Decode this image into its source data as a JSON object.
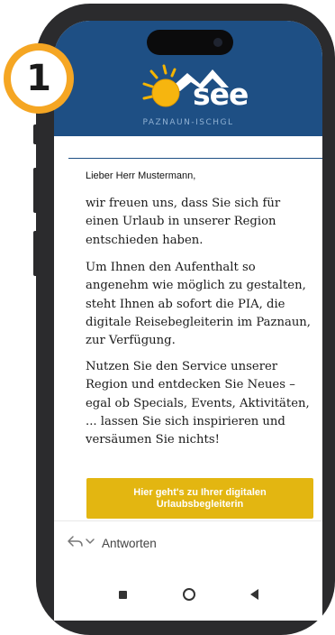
{
  "badge": {
    "number": "1"
  },
  "brand": {
    "logo_text": "see",
    "subtitle": "PAZNAUN-ISCHGL",
    "header_color": "#1e4f84",
    "accent_color": "#e3b611"
  },
  "email": {
    "greeting": "Lieber Herr Mustermann,",
    "paragraphs": [
      "wir freuen uns, dass Sie sich für einen Urlaub in unserer Region entschieden haben.",
      "Um Ihnen den Aufenthalt so angenehm wie möglich zu gestalten, steht Ihnen ab sofort die PIA, die digitale Reisebegleiterin im Paznaun, zur Verfügung.",
      "Nutzen Sie den Service unserer Region und entdecken Sie Neues – egal ob Specials, Events, Aktivitäten, ... lassen Sie sich inspirieren und versäumen Sie nichts!"
    ],
    "cta_label": "Hier geht's zu Ihrer digitalen Urlaubsbegleiterin"
  },
  "reply": {
    "label": "Antworten",
    "icon": "reply-icon",
    "chevron": "chevron-down-icon"
  },
  "navigation": {
    "recent": "recent-apps-icon",
    "home": "home-icon",
    "back": "back-icon"
  }
}
